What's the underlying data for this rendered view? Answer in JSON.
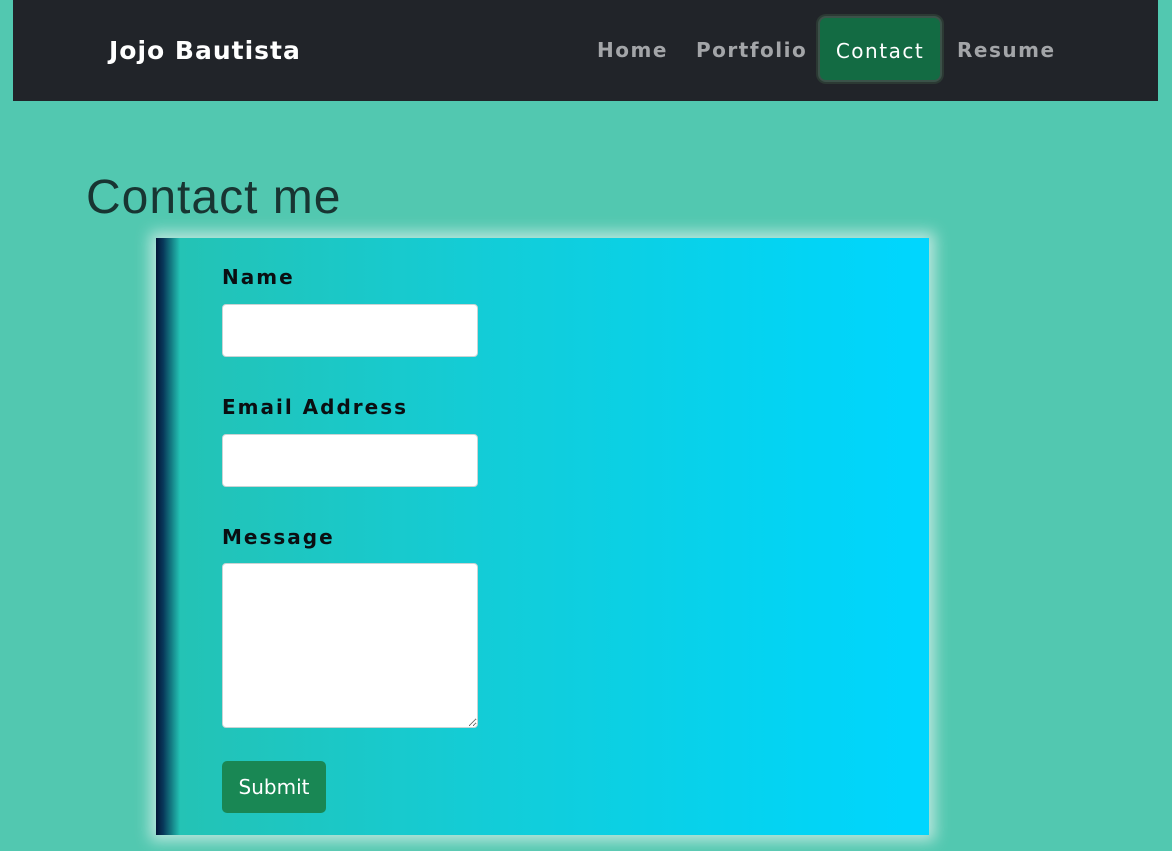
{
  "navbar": {
    "brand": "Jojo Bautista",
    "links": [
      {
        "label": "Home",
        "active": false
      },
      {
        "label": "Portfolio",
        "active": false
      },
      {
        "label": "Contact",
        "active": true
      },
      {
        "label": "Resume",
        "active": false
      }
    ]
  },
  "page": {
    "title": "Contact me"
  },
  "form": {
    "name_label": "Name",
    "name_value": "",
    "email_label": "Email Address",
    "email_value": "",
    "message_label": "Message",
    "message_value": "",
    "submit_label": "Submit"
  },
  "colors": {
    "background": "#52c8b0",
    "navbar": "#212429",
    "active_link": "#136b43",
    "submit": "#198754",
    "card_gradient_start": "#25c2b2",
    "card_gradient_end": "#00d6ff"
  }
}
